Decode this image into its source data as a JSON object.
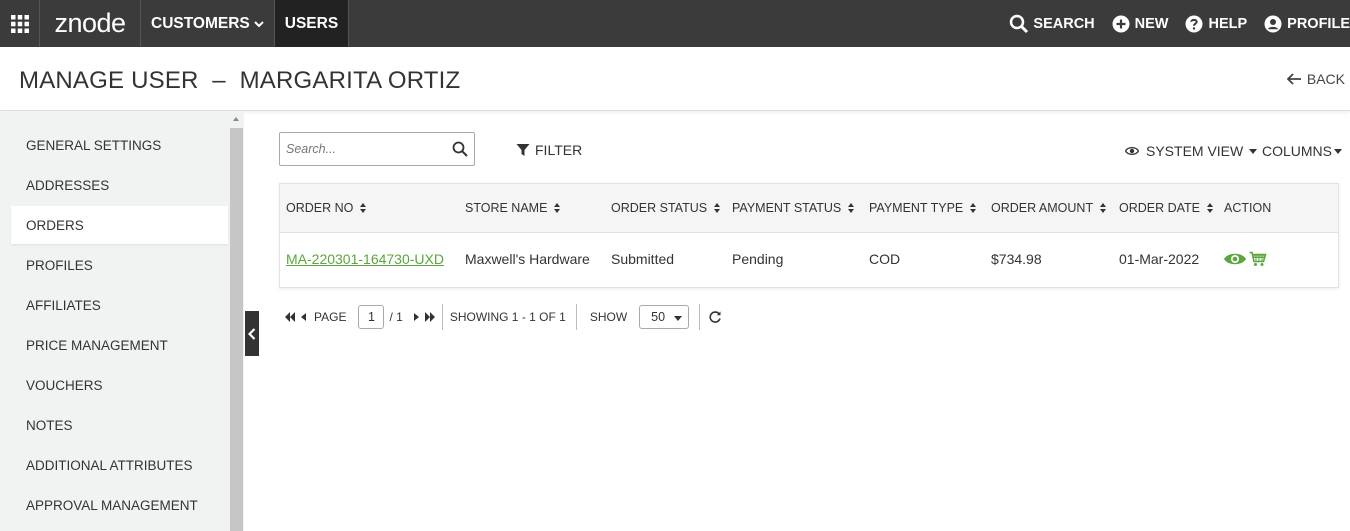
{
  "topbar": {
    "logo": "znode",
    "nav": [
      {
        "label": "CUSTOMERS",
        "has_dropdown": true,
        "active": false
      },
      {
        "label": "USERS",
        "has_dropdown": false,
        "active": true
      }
    ],
    "actions": [
      {
        "label": "SEARCH",
        "icon": "search-icon"
      },
      {
        "label": "NEW",
        "icon": "plus-circle-icon"
      },
      {
        "label": "HELP",
        "icon": "help-circle-icon"
      },
      {
        "label": "PROFILE",
        "icon": "user-circle-icon"
      }
    ]
  },
  "header": {
    "title": "MANAGE USER  –  MARGARITA ORTIZ",
    "back_label": "BACK"
  },
  "sidebar": {
    "items": [
      {
        "label": "GENERAL SETTINGS",
        "active": false
      },
      {
        "label": "ADDRESSES",
        "active": false
      },
      {
        "label": "ORDERS",
        "active": true
      },
      {
        "label": "PROFILES",
        "active": false
      },
      {
        "label": "AFFILIATES",
        "active": false
      },
      {
        "label": "PRICE MANAGEMENT",
        "active": false
      },
      {
        "label": "VOUCHERS",
        "active": false
      },
      {
        "label": "NOTES",
        "active": false
      },
      {
        "label": "ADDITIONAL ATTRIBUTES",
        "active": false
      },
      {
        "label": "APPROVAL MANAGEMENT",
        "active": false
      }
    ]
  },
  "toolbar": {
    "search_placeholder": "Search...",
    "search_value": "",
    "filter_label": "FILTER",
    "view_label": "SYSTEM VIEW",
    "columns_label": "COLUMNS"
  },
  "table": {
    "columns": [
      "ORDER NO",
      "STORE NAME",
      "ORDER STATUS",
      "PAYMENT STATUS",
      "PAYMENT TYPE",
      "ORDER AMOUNT",
      "ORDER DATE",
      "ACTION"
    ],
    "rows": [
      {
        "order_no": "MA-220301-164730-UXD",
        "store_name": "Maxwell's Hardware",
        "order_status": "Submitted",
        "payment_status": "Pending",
        "payment_type": "COD",
        "order_amount": "$734.98",
        "order_date": "01-Mar-2022"
      }
    ]
  },
  "pager": {
    "page_label": "PAGE",
    "page_value": "1",
    "page_total": "/ 1",
    "showing": "SHOWING 1 - 1 OF 1",
    "show_label": "SHOW",
    "page_size": "50"
  },
  "colors": {
    "topbar_bg": "#3b3b3b",
    "link_green": "#5ba63c",
    "sidebar_bg": "#f1f2f2"
  }
}
